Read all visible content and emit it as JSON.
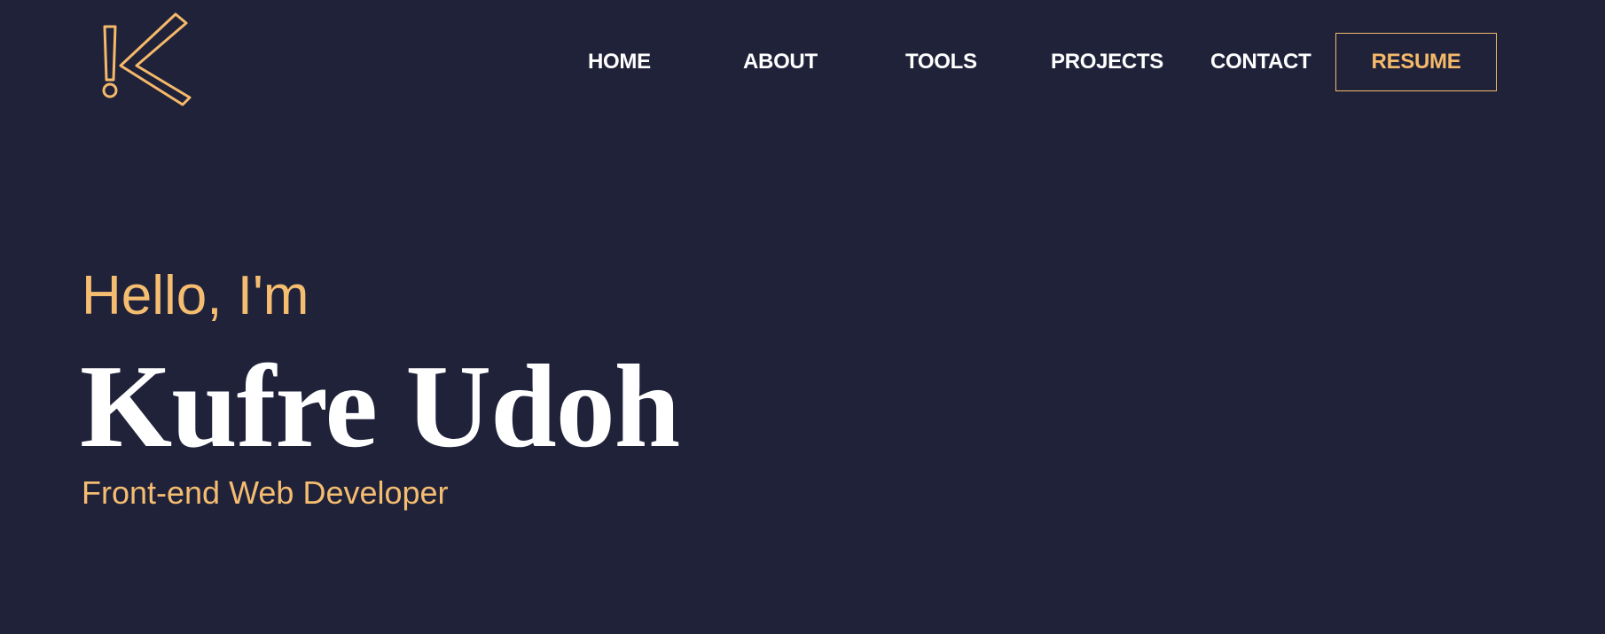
{
  "logo": {
    "icon": "k-logo-icon",
    "color": "#f5b96a"
  },
  "nav": {
    "items": [
      {
        "label": "HOME"
      },
      {
        "label": "ABOUT"
      },
      {
        "label": "TOOLS"
      },
      {
        "label": "PROJECTS"
      },
      {
        "label": "CONTACT"
      }
    ],
    "resume_label": "RESUME"
  },
  "hero": {
    "greeting": "Hello, I'm",
    "name": "Kufre Udoh",
    "role": "Front-end Web Developer"
  },
  "colors": {
    "background": "#20223a",
    "accent": "#f5b96a",
    "text": "#ffffff"
  }
}
